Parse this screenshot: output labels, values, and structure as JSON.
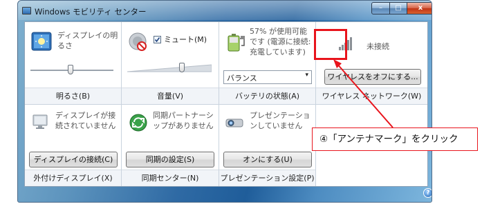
{
  "window": {
    "title": "Windows モビリティ センター",
    "minimize_glyph": "–",
    "maximize_glyph": "□",
    "close_glyph": "x"
  },
  "tiles": {
    "brightness": {
      "desc": "ディスプレイの明るさ",
      "title": "明るさ(B)",
      "level": 0.45,
      "icon": "display-brightness-icon"
    },
    "volume": {
      "checkbox_label": "ミュート(M)",
      "checkbox_checked": true,
      "title": "音量(V)",
      "level": 0.62,
      "icon": "speaker-muted-icon"
    },
    "battery": {
      "desc": "57% が使用可能です (電源に接続: 充電しています)",
      "select_value": "バランス",
      "title": "バッテリの状態(A)",
      "icon": "battery-charging-icon"
    },
    "wireless": {
      "desc": "未接続",
      "button": "ワイヤレスをオフにする...",
      "title": "ワイヤレス ネットワーク(W)",
      "icon": "antenna-signal-icon"
    },
    "external_display": {
      "desc": "ディスプレイが接続されていません",
      "button": "ディスプレイの接続(C)",
      "title": "外付けディスプレイ(X)",
      "icon": "monitor-icon"
    },
    "sync": {
      "desc": "同期パートナーシップがありません",
      "button": "同期の設定(S)",
      "title": "同期センター(N)",
      "icon": "sync-icon"
    },
    "presentation": {
      "desc": "プレゼンテーションしていません",
      "button": "オンにする(U)",
      "title": "プレゼンテーション設定(P)",
      "icon": "projector-icon"
    }
  },
  "annotation": {
    "callout": "④「アンテナマーク」をクリック",
    "color": "#e8141c"
  },
  "help_glyph": "?"
}
